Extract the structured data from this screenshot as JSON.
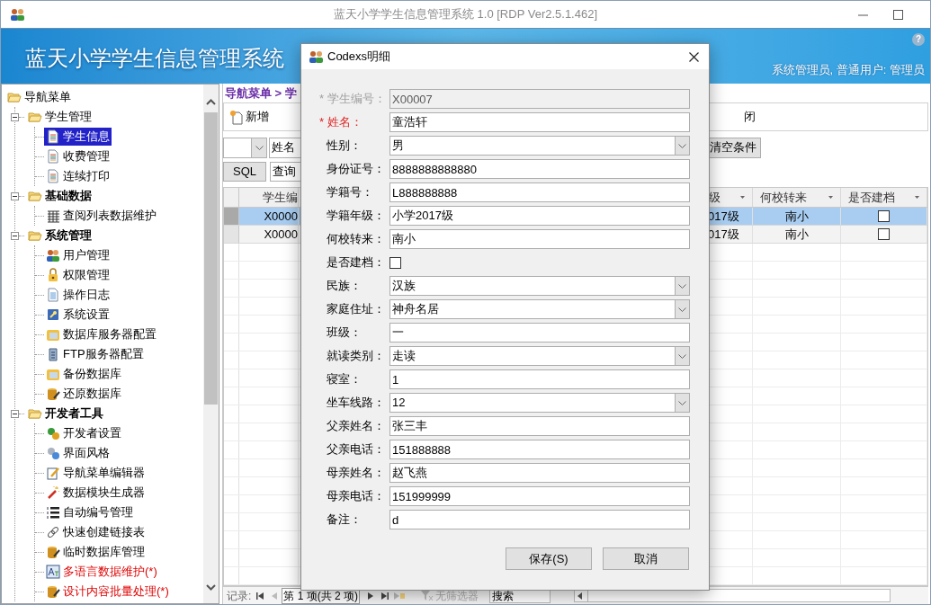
{
  "window": {
    "title": "蓝天小学学生信息管理系统 1.0 [RDP Ver2.5.1.462]"
  },
  "header": {
    "title": "蓝天小学学生信息管理系统",
    "help": "?",
    "user": "系统管理员, 普通用户: 管理员"
  },
  "nav_tree": {
    "label": "导航菜单",
    "children": [
      {
        "label": "学生管理",
        "bold": false,
        "expanded": true,
        "children": [
          {
            "label": "学生信息",
            "selected": true,
            "kind": "plain"
          },
          {
            "label": "收费管理",
            "selected": false,
            "kind": "plain"
          },
          {
            "label": "连续打印",
            "selected": false,
            "kind": "plain"
          }
        ]
      },
      {
        "label": "基础数据",
        "bold": true,
        "expanded": true,
        "children": [
          {
            "label": "查阅列表数据维护",
            "selected": false,
            "kind": "plain"
          }
        ]
      },
      {
        "label": "系统管理",
        "bold": true,
        "expanded": true,
        "children": [
          {
            "label": "用户管理",
            "selected": false,
            "kind": "plain"
          },
          {
            "label": "权限管理",
            "selected": false,
            "kind": "plain"
          },
          {
            "label": "操作日志",
            "selected": false,
            "kind": "plain"
          },
          {
            "label": "系统设置",
            "selected": false,
            "kind": "plain"
          },
          {
            "label": "数据库服务器配置",
            "selected": false,
            "kind": "plain"
          },
          {
            "label": "FTP服务器配置",
            "selected": false,
            "kind": "plain"
          },
          {
            "label": "备份数据库",
            "selected": false,
            "kind": "plain"
          },
          {
            "label": "还原数据库",
            "selected": false,
            "kind": "plain"
          }
        ]
      },
      {
        "label": "开发者工具",
        "bold": true,
        "expanded": true,
        "children": [
          {
            "label": "开发者设置",
            "selected": false,
            "kind": "plain"
          },
          {
            "label": "界面风格",
            "selected": false,
            "kind": "plain"
          },
          {
            "label": "导航菜单编辑器",
            "selected": false,
            "kind": "plain"
          },
          {
            "label": "数据模块生成器",
            "selected": false,
            "kind": "plain"
          },
          {
            "label": "自动编号管理",
            "selected": false,
            "kind": "plain"
          },
          {
            "label": "快速创建链接表",
            "selected": false,
            "kind": "plain"
          },
          {
            "label": "临时数据库管理",
            "selected": false,
            "kind": "plain"
          },
          {
            "label": "多语言数据维护(*)",
            "selected": false,
            "kind": "flagged"
          },
          {
            "label": "设计内容批量处理(*)",
            "selected": false,
            "kind": "flagged"
          }
        ]
      }
    ]
  },
  "breadcrumb": "导航菜单 > 学",
  "toolbar": {
    "new_button": "新增",
    "close_button": "闭"
  },
  "filter": {
    "field": "姓名",
    "clear_button": "清空条件",
    "sql_button": "SQL",
    "query_field": "查询"
  },
  "grid": {
    "columns": [
      {
        "label": "学生编",
        "kind": "text"
      },
      {
        "label": "级",
        "kind": "text"
      },
      {
        "label": "何校转来",
        "kind": "text"
      },
      {
        "label": "是否建档",
        "kind": "check"
      }
    ],
    "rows": [
      {
        "selected": true,
        "cells": [
          {
            "text": "X0000"
          },
          {
            "text": "017级"
          },
          {
            "text": "南小"
          },
          {
            "checked": false
          }
        ]
      },
      {
        "selected": false,
        "cells": [
          {
            "text": "X0000"
          },
          {
            "text": "017级"
          },
          {
            "text": "南小"
          },
          {
            "checked": false
          }
        ]
      }
    ]
  },
  "pager": {
    "label": "记录:",
    "position": "第 1 项(共 2 项)",
    "filter_status": "无筛选器",
    "search_placeholder": "搜索"
  },
  "dialog": {
    "title": "Codexs明细",
    "fields": [
      {
        "label": "* 学生编号：",
        "kind": "text",
        "value": "X00007",
        "required": true,
        "disabled": true
      },
      {
        "label": "* 姓名：",
        "kind": "text",
        "value": "童浩轩",
        "required": true,
        "disabled": false
      },
      {
        "label": "性别：",
        "kind": "select",
        "value": "男",
        "required": false,
        "disabled": false
      },
      {
        "label": "身份证号：",
        "kind": "text",
        "value": "8888888888880",
        "required": false,
        "disabled": false
      },
      {
        "label": "学籍号：",
        "kind": "text",
        "value": "L888888888",
        "required": false,
        "disabled": false
      },
      {
        "label": "学籍年级：",
        "kind": "text",
        "value": "小学2017级",
        "required": false,
        "disabled": false
      },
      {
        "label": "何校转来：",
        "kind": "text",
        "value": "南小",
        "required": false,
        "disabled": false
      },
      {
        "label": "是否建档：",
        "kind": "check",
        "checked": false,
        "required": false,
        "disabled": false
      },
      {
        "label": "民族：",
        "kind": "select",
        "value": "汉族",
        "required": false,
        "disabled": false
      },
      {
        "label": "家庭住址：",
        "kind": "select",
        "value": "神舟名居",
        "required": false,
        "disabled": false
      },
      {
        "label": "班级：",
        "kind": "text",
        "value": "一",
        "required": false,
        "disabled": false
      },
      {
        "label": "就读类别：",
        "kind": "select",
        "value": "走读",
        "required": false,
        "disabled": false
      },
      {
        "label": "寝室：",
        "kind": "text",
        "value": "1",
        "required": false,
        "disabled": false
      },
      {
        "label": "坐车线路：",
        "kind": "select",
        "value": "12",
        "required": false,
        "disabled": false
      },
      {
        "label": "父亲姓名：",
        "kind": "text",
        "value": "张三丰",
        "required": false,
        "disabled": false
      },
      {
        "label": "父亲电话：",
        "kind": "text",
        "value": "151888888",
        "required": false,
        "disabled": false
      },
      {
        "label": "母亲姓名：",
        "kind": "text",
        "value": "赵飞燕",
        "required": false,
        "disabled": false
      },
      {
        "label": "母亲电话：",
        "kind": "text",
        "value": "151999999",
        "required": false,
        "disabled": false
      },
      {
        "label": "备注：",
        "kind": "text",
        "value": "d",
        "required": false,
        "disabled": false
      }
    ],
    "buttons": [
      {
        "label": "保存(S)"
      },
      {
        "label": "取消"
      }
    ]
  }
}
